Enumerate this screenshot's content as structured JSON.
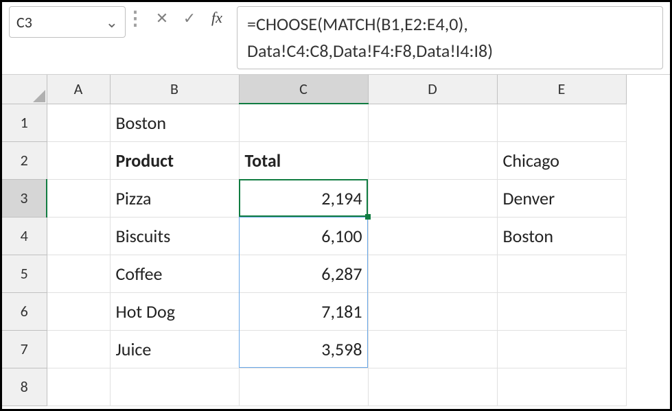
{
  "formula_bar": {
    "name_box": "C3",
    "formula": "=CHOOSE(MATCH(B1,E2:E4,0),\nData!C4:C8,Data!F4:F8,Data!I4:I8)"
  },
  "columns": [
    "A",
    "B",
    "C",
    "D",
    "E"
  ],
  "rows": [
    "1",
    "2",
    "3",
    "4",
    "5",
    "6",
    "7",
    "8"
  ],
  "active_col": "C",
  "active_row": "3",
  "cells": {
    "B1": "Boston",
    "B2": "Product",
    "C2": "Total",
    "E2": "Chicago",
    "B3": "Pizza",
    "C3": "2,194",
    "E3": "Denver",
    "B4": "Biscuits",
    "C4": "6,100",
    "E4": "Boston",
    "B5": "Coffee",
    "C5": "6,287",
    "B6": "Hot Dog",
    "C6": "7,181",
    "B7": "Juice",
    "C7": "3,598"
  },
  "icons": {
    "cancel": "✕",
    "enter": "✓",
    "fx": "fx",
    "chevron": "⌄"
  }
}
